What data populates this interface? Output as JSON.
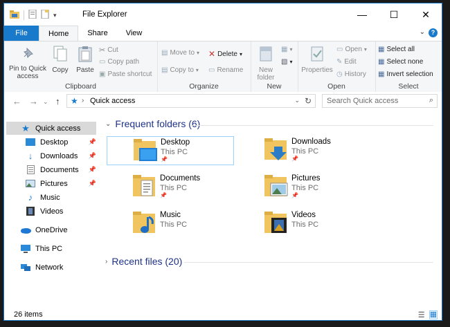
{
  "window": {
    "title": "File Explorer"
  },
  "tabs": [
    {
      "label": "File"
    },
    {
      "label": "Home"
    },
    {
      "label": "Share"
    },
    {
      "label": "View"
    }
  ],
  "ribbon": {
    "clipboard": {
      "pin_label": "Pin to Quick access",
      "copy_label": "Copy",
      "paste_label": "Paste",
      "cut_label": "Cut",
      "copy_path_label": "Copy path",
      "paste_shortcut_label": "Paste shortcut",
      "group_label": "Clipboard"
    },
    "organize": {
      "move_to_label": "Move to",
      "copy_to_label": "Copy to",
      "delete_label": "Delete",
      "rename_label": "Rename",
      "group_label": "Organize"
    },
    "new": {
      "new_folder_label": "New folder",
      "group_label": "New"
    },
    "open": {
      "properties_label": "Properties",
      "open_label": "Open",
      "edit_label": "Edit",
      "history_label": "History",
      "group_label": "Open"
    },
    "select": {
      "select_all_label": "Select all",
      "select_none_label": "Select none",
      "invert_label": "Invert selection",
      "group_label": "Select"
    }
  },
  "address": {
    "path": "Quick access",
    "search_placeholder": "Search Quick access"
  },
  "nav": {
    "items": [
      {
        "label": "Quick access"
      },
      {
        "label": "Desktop"
      },
      {
        "label": "Downloads"
      },
      {
        "label": "Documents"
      },
      {
        "label": "Pictures"
      },
      {
        "label": "Music"
      },
      {
        "label": "Videos"
      },
      {
        "label": "OneDrive"
      },
      {
        "label": "This PC"
      },
      {
        "label": "Network"
      }
    ]
  },
  "frequent": {
    "heading": "Frequent folders (6)",
    "folders": [
      {
        "name": "Desktop",
        "location": "This PC"
      },
      {
        "name": "Downloads",
        "location": "This PC"
      },
      {
        "name": "Documents",
        "location": "This PC"
      },
      {
        "name": "Pictures",
        "location": "This PC"
      },
      {
        "name": "Music",
        "location": "This PC"
      },
      {
        "name": "Videos",
        "location": "This PC"
      }
    ]
  },
  "recent": {
    "heading": "Recent files (20)"
  },
  "status": {
    "item_count": "26 items"
  },
  "colors": {
    "accent": "#1979ca",
    "folder": "#f0c560",
    "heading": "#1e3287"
  }
}
